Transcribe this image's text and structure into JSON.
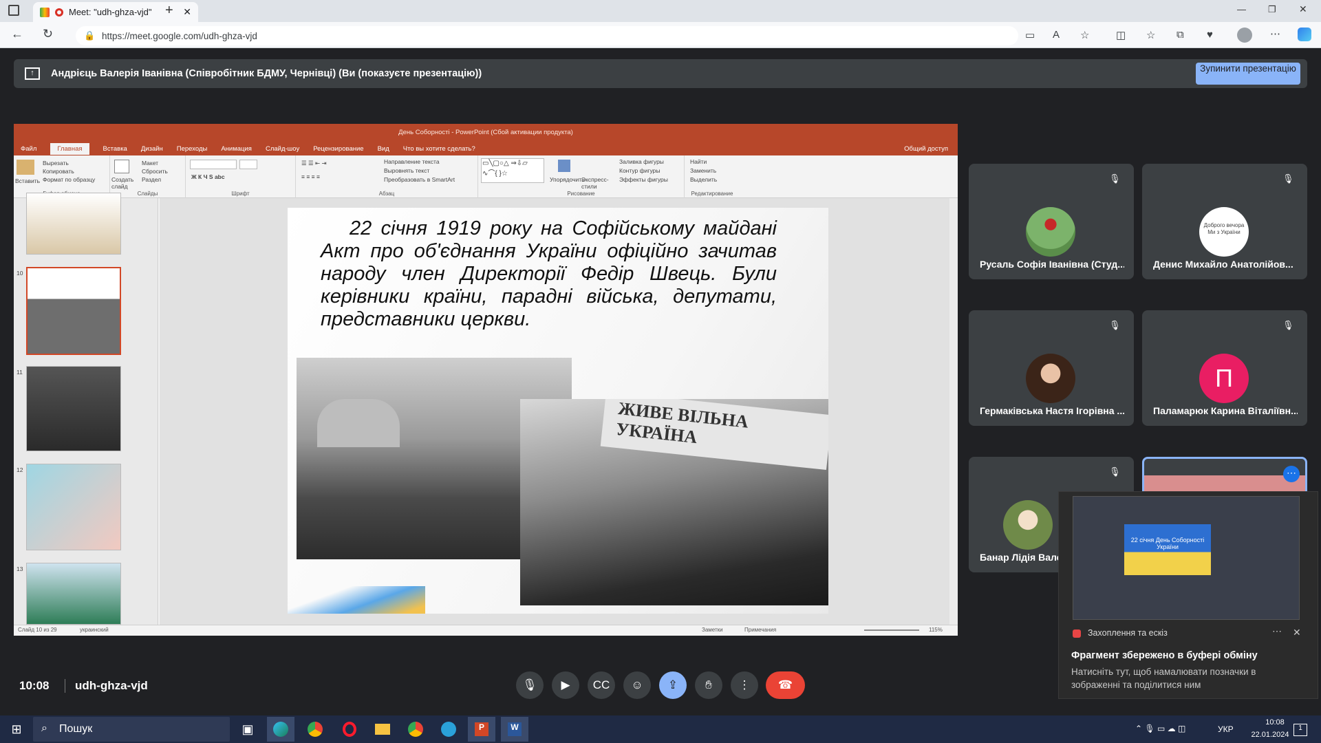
{
  "browser": {
    "tab_title": "Meet: \"udh-ghza-vjd\"",
    "url": "https://meet.google.com/udh-ghza-vjd"
  },
  "banner": {
    "text": "Андрієць Валерія Іванівна (Співробітник БДМУ, Чернівці) (Ви (показуєте презентацію))",
    "stop_button": "Зупинити презентацію"
  },
  "powerpoint": {
    "window_title": "День Соборності - PowerPoint (Сбой активации продукта)",
    "tabs": [
      "Файл",
      "Главная",
      "Вставка",
      "Дизайн",
      "Переходы",
      "Анимация",
      "Слайд-шоу",
      "Рецензирование",
      "Вид"
    ],
    "tell_me": "Что вы хотите сделать?",
    "share": "Общий доступ",
    "ribbon": {
      "paste": "Вставить",
      "cut": "Вырезать",
      "copy": "Копировать",
      "format_painter": "Формат по образцу",
      "clipboard_label": "Буфер обмена",
      "new_slide": "Создать слайд",
      "layout": "Макет",
      "reset": "Сбросить",
      "section": "Раздел",
      "slides_label": "Слайды",
      "font_label": "Шрифт",
      "text_direction": "Направление текста",
      "align_text": "Выровнять текст",
      "smartart": "Преобразовать в SmartArt",
      "paragraph_label": "Абзац",
      "arrange": "Упорядочить",
      "quick_styles": "Экспресс-стили",
      "shape_fill": "Заливка фигуры",
      "shape_outline": "Контур фигуры",
      "shape_effects": "Эффекты фигуры",
      "drawing_label": "Рисование",
      "find": "Найти",
      "replace": "Заменить",
      "select": "Выделить",
      "editing_label": "Редактирование"
    },
    "thumbnails": [
      {
        "num": "10"
      },
      {
        "num": "11"
      },
      {
        "num": "12"
      },
      {
        "num": "13"
      }
    ],
    "slide_text": "22 січня 1919 року на Софійському майдані Акт про об'єднання України офіційно зачитав народу член Директорії Федір Швець. Були керівники країни, парадні війська, депутати, представники церкви.",
    "photo2_banner": "ЖИВЕ ВІЛЬНА УКРАЇНА",
    "status": {
      "slide_of": "Слайд 10 из 29",
      "language": "украинский",
      "notes": "Заметки",
      "comments": "Примечания",
      "zoom": "115%"
    }
  },
  "participants": [
    {
      "name": "Русаль Софія Іванівна (Студ...",
      "muted": true
    },
    {
      "name": "Денис Михайло Анатолійов...",
      "muted": true,
      "avatar_text": "Доброго вечора Ми з України"
    },
    {
      "name": "Гермаківська Настя Ігорівна ...",
      "muted": true
    },
    {
      "name": "Паламарюк Карина Віталіївн...",
      "muted": true,
      "initial": "П",
      "avatar_color": "#e91e63"
    },
    {
      "name": "Банар Лідія Вале",
      "muted": true
    }
  ],
  "bottom_bar": {
    "time": "10:08",
    "meeting_code": "udh-ghza-vjd"
  },
  "notification": {
    "app": "Захоплення та ескіз",
    "title": "Фрагмент збережено в буфері обміну",
    "body": "Натисніть тут, щоб намалювати позначки в зображенні та поділитися ним",
    "preview_text": "22 січня День Соборності України"
  },
  "taskbar": {
    "search": "Пошук",
    "language": "УКР",
    "time": "10:08",
    "date": "22.01.2024",
    "notif_count": "1"
  },
  "colors": {
    "meet_bg": "#202124",
    "accent_blue": "#8ab4f8",
    "end_call_red": "#ea4335",
    "ppt_orange": "#b7472a"
  }
}
